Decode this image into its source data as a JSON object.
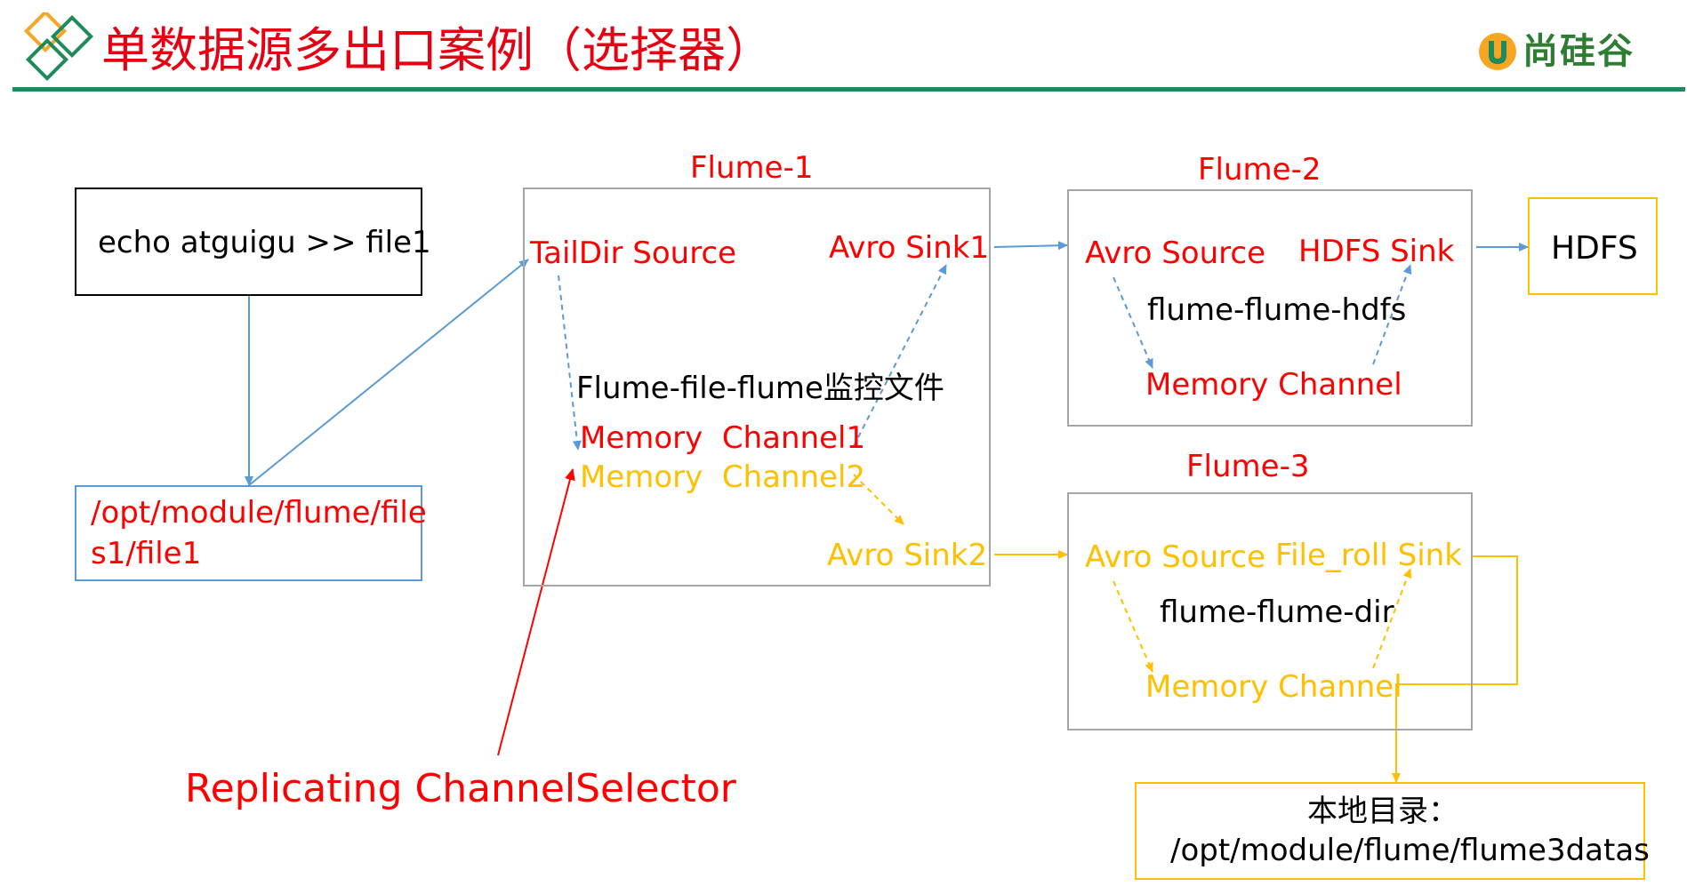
{
  "header": {
    "title": "单数据源多出口案例（选择器）",
    "logo_text": "尚硅谷"
  },
  "diagram": {
    "source_box": {
      "label": "echo atguigu >> file1"
    },
    "file_box": {
      "line1": "/opt/module/flume/file",
      "line2": "s1/file1"
    },
    "flume1": {
      "title": "Flume-1",
      "source": "TailDir Source",
      "sink1": "Avro Sink1",
      "sink2": "Avro Sink2",
      "config_name": "Flume-file-flume监控文件",
      "channel1": "Memory  Channel1",
      "channel2": "Memory  Channel2"
    },
    "flume2": {
      "title": "Flume-2",
      "source": "Avro Source",
      "sink": "HDFS Sink",
      "config_name": "flume-flume-hdfs",
      "channel": "Memory Channel"
    },
    "flume3": {
      "title": "Flume-3",
      "source": "Avro Source",
      "sink": "File_roll Sink",
      "config_name": "flume-flume-dir",
      "channel": "Memory Channel"
    },
    "hdfs_box": {
      "label": "HDFS"
    },
    "local_dir_box": {
      "line1": "本地目录：",
      "line2": "/opt/module/flume/flume3datas"
    },
    "selector_label": "Replicating ChannelSelector",
    "colors": {
      "red": "#ff0000",
      "amber": "#ffc000",
      "blue": "#5b9bd5",
      "gray": "#a6a6a6",
      "green": "#1f8a5b"
    }
  }
}
